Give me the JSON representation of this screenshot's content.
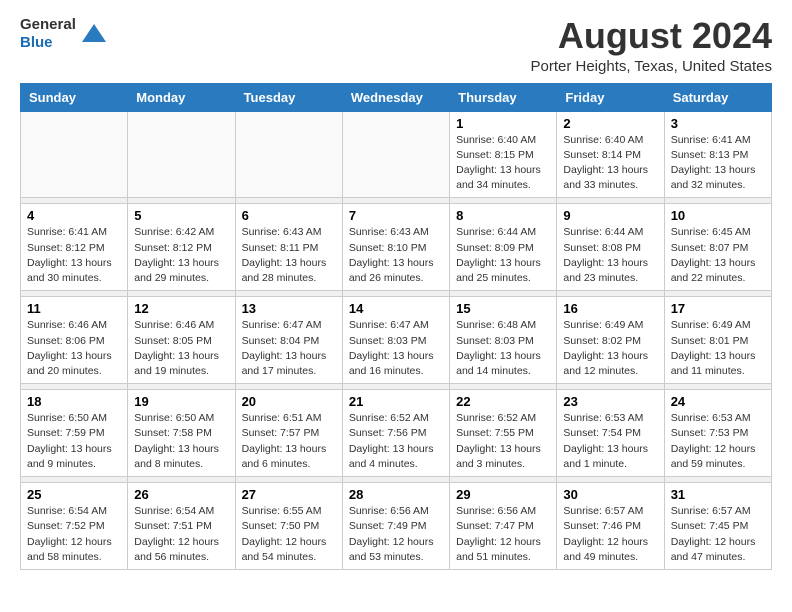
{
  "header": {
    "logo_line1": "General",
    "logo_line2": "Blue",
    "month": "August 2024",
    "location": "Porter Heights, Texas, United States"
  },
  "weekdays": [
    "Sunday",
    "Monday",
    "Tuesday",
    "Wednesday",
    "Thursday",
    "Friday",
    "Saturday"
  ],
  "weeks": [
    {
      "days": [
        {
          "num": "",
          "info": ""
        },
        {
          "num": "",
          "info": ""
        },
        {
          "num": "",
          "info": ""
        },
        {
          "num": "",
          "info": ""
        },
        {
          "num": "1",
          "info": "Sunrise: 6:40 AM\nSunset: 8:15 PM\nDaylight: 13 hours\nand 34 minutes."
        },
        {
          "num": "2",
          "info": "Sunrise: 6:40 AM\nSunset: 8:14 PM\nDaylight: 13 hours\nand 33 minutes."
        },
        {
          "num": "3",
          "info": "Sunrise: 6:41 AM\nSunset: 8:13 PM\nDaylight: 13 hours\nand 32 minutes."
        }
      ]
    },
    {
      "days": [
        {
          "num": "4",
          "info": "Sunrise: 6:41 AM\nSunset: 8:12 PM\nDaylight: 13 hours\nand 30 minutes."
        },
        {
          "num": "5",
          "info": "Sunrise: 6:42 AM\nSunset: 8:12 PM\nDaylight: 13 hours\nand 29 minutes."
        },
        {
          "num": "6",
          "info": "Sunrise: 6:43 AM\nSunset: 8:11 PM\nDaylight: 13 hours\nand 28 minutes."
        },
        {
          "num": "7",
          "info": "Sunrise: 6:43 AM\nSunset: 8:10 PM\nDaylight: 13 hours\nand 26 minutes."
        },
        {
          "num": "8",
          "info": "Sunrise: 6:44 AM\nSunset: 8:09 PM\nDaylight: 13 hours\nand 25 minutes."
        },
        {
          "num": "9",
          "info": "Sunrise: 6:44 AM\nSunset: 8:08 PM\nDaylight: 13 hours\nand 23 minutes."
        },
        {
          "num": "10",
          "info": "Sunrise: 6:45 AM\nSunset: 8:07 PM\nDaylight: 13 hours\nand 22 minutes."
        }
      ]
    },
    {
      "days": [
        {
          "num": "11",
          "info": "Sunrise: 6:46 AM\nSunset: 8:06 PM\nDaylight: 13 hours\nand 20 minutes."
        },
        {
          "num": "12",
          "info": "Sunrise: 6:46 AM\nSunset: 8:05 PM\nDaylight: 13 hours\nand 19 minutes."
        },
        {
          "num": "13",
          "info": "Sunrise: 6:47 AM\nSunset: 8:04 PM\nDaylight: 13 hours\nand 17 minutes."
        },
        {
          "num": "14",
          "info": "Sunrise: 6:47 AM\nSunset: 8:03 PM\nDaylight: 13 hours\nand 16 minutes."
        },
        {
          "num": "15",
          "info": "Sunrise: 6:48 AM\nSunset: 8:03 PM\nDaylight: 13 hours\nand 14 minutes."
        },
        {
          "num": "16",
          "info": "Sunrise: 6:49 AM\nSunset: 8:02 PM\nDaylight: 13 hours\nand 12 minutes."
        },
        {
          "num": "17",
          "info": "Sunrise: 6:49 AM\nSunset: 8:01 PM\nDaylight: 13 hours\nand 11 minutes."
        }
      ]
    },
    {
      "days": [
        {
          "num": "18",
          "info": "Sunrise: 6:50 AM\nSunset: 7:59 PM\nDaylight: 13 hours\nand 9 minutes."
        },
        {
          "num": "19",
          "info": "Sunrise: 6:50 AM\nSunset: 7:58 PM\nDaylight: 13 hours\nand 8 minutes."
        },
        {
          "num": "20",
          "info": "Sunrise: 6:51 AM\nSunset: 7:57 PM\nDaylight: 13 hours\nand 6 minutes."
        },
        {
          "num": "21",
          "info": "Sunrise: 6:52 AM\nSunset: 7:56 PM\nDaylight: 13 hours\nand 4 minutes."
        },
        {
          "num": "22",
          "info": "Sunrise: 6:52 AM\nSunset: 7:55 PM\nDaylight: 13 hours\nand 3 minutes."
        },
        {
          "num": "23",
          "info": "Sunrise: 6:53 AM\nSunset: 7:54 PM\nDaylight: 13 hours\nand 1 minute."
        },
        {
          "num": "24",
          "info": "Sunrise: 6:53 AM\nSunset: 7:53 PM\nDaylight: 12 hours\nand 59 minutes."
        }
      ]
    },
    {
      "days": [
        {
          "num": "25",
          "info": "Sunrise: 6:54 AM\nSunset: 7:52 PM\nDaylight: 12 hours\nand 58 minutes."
        },
        {
          "num": "26",
          "info": "Sunrise: 6:54 AM\nSunset: 7:51 PM\nDaylight: 12 hours\nand 56 minutes."
        },
        {
          "num": "27",
          "info": "Sunrise: 6:55 AM\nSunset: 7:50 PM\nDaylight: 12 hours\nand 54 minutes."
        },
        {
          "num": "28",
          "info": "Sunrise: 6:56 AM\nSunset: 7:49 PM\nDaylight: 12 hours\nand 53 minutes."
        },
        {
          "num": "29",
          "info": "Sunrise: 6:56 AM\nSunset: 7:47 PM\nDaylight: 12 hours\nand 51 minutes."
        },
        {
          "num": "30",
          "info": "Sunrise: 6:57 AM\nSunset: 7:46 PM\nDaylight: 12 hours\nand 49 minutes."
        },
        {
          "num": "31",
          "info": "Sunrise: 6:57 AM\nSunset: 7:45 PM\nDaylight: 12 hours\nand 47 minutes."
        }
      ]
    }
  ]
}
